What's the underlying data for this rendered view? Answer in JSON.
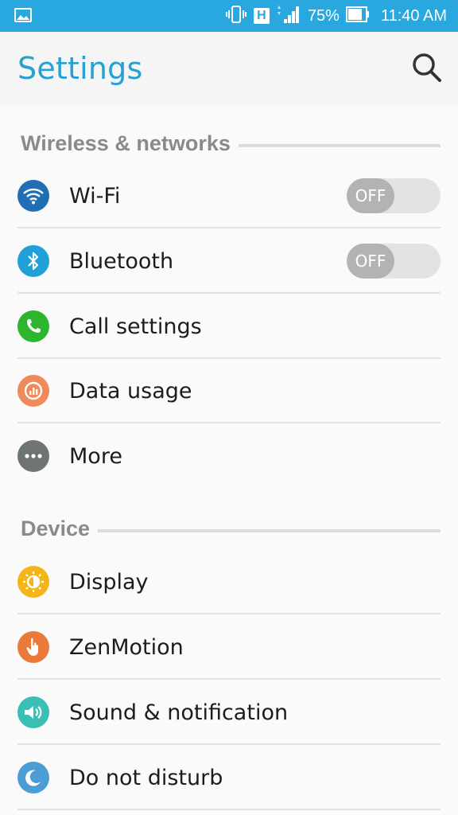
{
  "status_bar": {
    "battery_percent": "75%",
    "time": "11:40 AM",
    "network_type": "H",
    "icons": [
      "gallery-icon",
      "vibrate-icon",
      "network-h-icon",
      "signal-icon",
      "battery-icon"
    ]
  },
  "header": {
    "title": "Settings",
    "search_icon": "search-icon"
  },
  "sections": {
    "wireless": "Wireless & networks",
    "device": "Device"
  },
  "rows": {
    "wifi": {
      "label": "Wi-Fi",
      "toggle": "OFF",
      "icon": "wifi-icon",
      "color": "#1f6fb2"
    },
    "bluetooth": {
      "label": "Bluetooth",
      "toggle": "OFF",
      "icon": "bluetooth-icon",
      "color": "#21a0d8"
    },
    "call": {
      "label": "Call settings",
      "icon": "phone-icon",
      "color": "#2db52d"
    },
    "data": {
      "label": "Data usage",
      "icon": "data-usage-icon",
      "color": "#ef8a5c"
    },
    "more": {
      "label": "More",
      "icon": "more-icon",
      "color": "#6e7570"
    },
    "display": {
      "label": "Display",
      "icon": "display-icon",
      "color": "#f6b516"
    },
    "zenmotion": {
      "label": "ZenMotion",
      "icon": "zenmotion-icon",
      "color": "#ea7a3a"
    },
    "sound": {
      "label": "Sound & notification",
      "icon": "sound-icon",
      "color": "#3bbfb5"
    },
    "dnd": {
      "label": "Do not disturb",
      "icon": "moon-icon",
      "color": "#4c9dd6"
    }
  },
  "colors": {
    "accent": "#29a8e0",
    "title": "#27a0d2"
  }
}
